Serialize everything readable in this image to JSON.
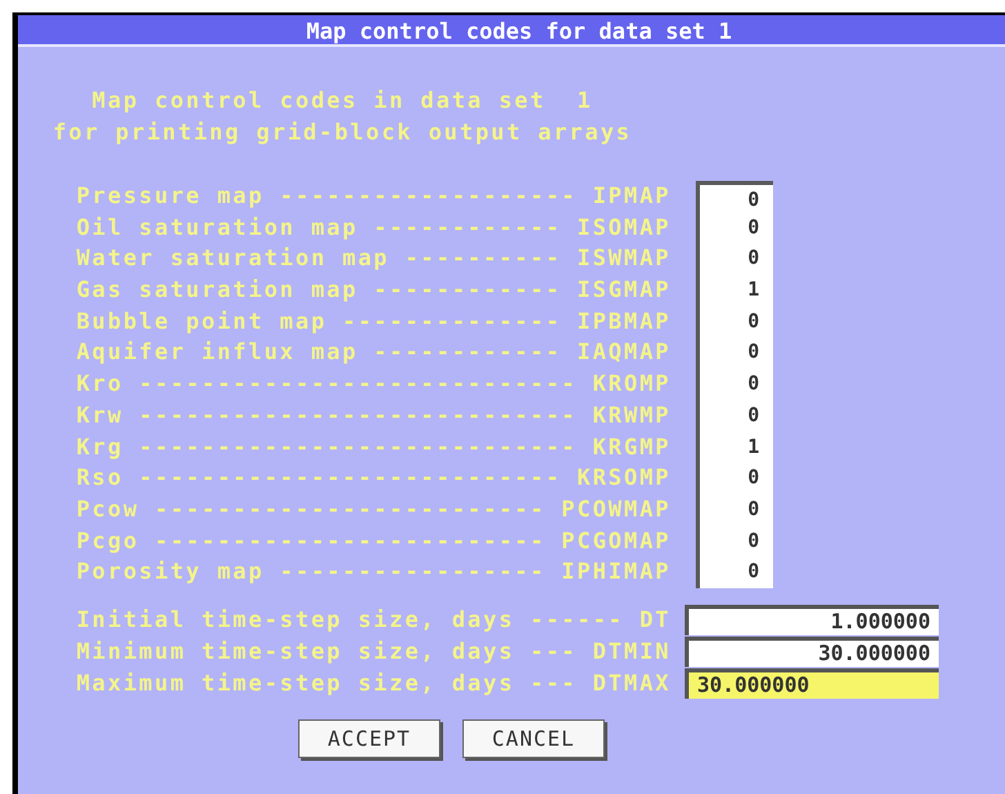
{
  "window": {
    "title": "Map control codes for data set  1"
  },
  "heading": [
    "Map control codes in data set  1",
    "for printing grid-block output arrays"
  ],
  "map_codes": [
    {
      "label": "Pressure map ------------------- IPMAP",
      "value": "0"
    },
    {
      "label": "Oil saturation map ------------ ISOMAP",
      "value": "0"
    },
    {
      "label": "Water saturation map ---------- ISWMAP",
      "value": "0"
    },
    {
      "label": "Gas saturation map ------------ ISGMAP",
      "value": "1"
    },
    {
      "label": "Bubble point map -------------- IPBMAP",
      "value": "0"
    },
    {
      "label": "Aquifer influx map ------------ IAQMAP",
      "value": "0"
    },
    {
      "label": "Kro ---------------------------- KROMP",
      "value": "0"
    },
    {
      "label": "Krw ---------------------------- KRWMP",
      "value": "0"
    },
    {
      "label": "Krg ---------------------------- KRGMP",
      "value": "1"
    },
    {
      "label": "Rso --------------------------- KRSOMP",
      "value": "0"
    },
    {
      "label": "Pcow ------------------------- PCOWMAP",
      "value": "0"
    },
    {
      "label": "Pcgo ------------------------- PCGOMAP",
      "value": "0"
    },
    {
      "label": "Porosity map ----------------- IPHIMAP",
      "value": "0"
    }
  ],
  "time_steps": [
    {
      "label": "Initial time-step size, days ------ DT",
      "value": "1.000000",
      "focused": false
    },
    {
      "label": "Minimum time-step size, days --- DTMIN",
      "value": "30.000000",
      "focused": false
    },
    {
      "label": "Maximum time-step size, days --- DTMAX",
      "value": "30.000000",
      "focused": true
    }
  ],
  "buttons": [
    "ACCEPT",
    "CANCEL"
  ]
}
